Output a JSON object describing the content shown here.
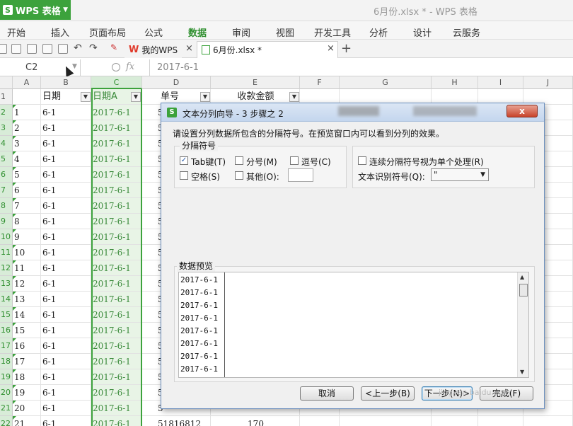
{
  "app": {
    "name": "WPS 表格",
    "logo": "S",
    "window_title": "6月份.xlsx * - WPS 表格"
  },
  "menu": {
    "items": [
      "开始",
      "插入",
      "页面布局",
      "公式",
      "数据",
      "审阅",
      "视图",
      "开发工具",
      "分析",
      "设计",
      "云服务"
    ],
    "active": "数据"
  },
  "tabs": {
    "home_label": "我的WPS",
    "doc_label": "6月份.xlsx *",
    "close_glyph": "×",
    "add_glyph": "+"
  },
  "formula": {
    "cell_ref": "C2",
    "fx": "fx",
    "value": "2017-6-1"
  },
  "sheet": {
    "columns": [
      "A",
      "B",
      "C",
      "D",
      "E",
      "F",
      "G",
      "H",
      "I",
      "J"
    ],
    "header_row": {
      "a": "",
      "b": "日期",
      "c": "日期A",
      "d": "单号",
      "e": "收款金额"
    },
    "rows": [
      {
        "n": "1",
        "a": "",
        "b": "",
        "c": ""
      },
      {
        "n": "2",
        "a": "1",
        "b": "6-1",
        "c": "2017-6-1"
      },
      {
        "n": "3",
        "a": "2",
        "b": "6-1",
        "c": "2017-6-1"
      },
      {
        "n": "4",
        "a": "3",
        "b": "6-1",
        "c": "2017-6-1"
      },
      {
        "n": "5",
        "a": "4",
        "b": "6-1",
        "c": "2017-6-1"
      },
      {
        "n": "6",
        "a": "5",
        "b": "6-1",
        "c": "2017-6-1"
      },
      {
        "n": "7",
        "a": "6",
        "b": "6-1",
        "c": "2017-6-1"
      },
      {
        "n": "8",
        "a": "7",
        "b": "6-1",
        "c": "2017-6-1"
      },
      {
        "n": "9",
        "a": "8",
        "b": "6-1",
        "c": "2017-6-1"
      },
      {
        "n": "10",
        "a": "9",
        "b": "6-1",
        "c": "2017-6-1"
      },
      {
        "n": "11",
        "a": "10",
        "b": "6-1",
        "c": "2017-6-1"
      },
      {
        "n": "12",
        "a": "11",
        "b": "6-1",
        "c": "2017-6-1"
      },
      {
        "n": "13",
        "a": "12",
        "b": "6-1",
        "c": "2017-6-1"
      },
      {
        "n": "14",
        "a": "13",
        "b": "6-1",
        "c": "2017-6-1"
      },
      {
        "n": "15",
        "a": "14",
        "b": "6-1",
        "c": "2017-6-1"
      },
      {
        "n": "16",
        "a": "15",
        "b": "6-1",
        "c": "2017-6-1"
      },
      {
        "n": "17",
        "a": "16",
        "b": "6-1",
        "c": "2017-6-1"
      },
      {
        "n": "18",
        "a": "17",
        "b": "6-1",
        "c": "2017-6-1"
      },
      {
        "n": "19",
        "a": "18",
        "b": "6-1",
        "c": "2017-6-1"
      },
      {
        "n": "20",
        "a": "19",
        "b": "6-1",
        "c": "2017-6-1"
      },
      {
        "n": "21",
        "a": "20",
        "b": "6-1",
        "c": "2017-6-1"
      },
      {
        "n": "22",
        "a": "21",
        "b": "6-1",
        "c": "2017-6-1"
      }
    ],
    "last_row": {
      "d": "51816812",
      "e": "170"
    },
    "d_partial": "5",
    "filter_glyph": "▼"
  },
  "dialog": {
    "logo": "S",
    "title": "文本分列向导 - 3 步骤之 2",
    "close_glyph": "x",
    "instruction": "请设置分列数据所包含的分隔符号。在预览窗口内可以看到分列的效果。",
    "delimiter_group": "分隔符号",
    "tab": {
      "label": "Tab键(T)",
      "checked": true
    },
    "semicolon": {
      "label": "分号(M)",
      "checked": false
    },
    "comma": {
      "label": "逗号(C)",
      "checked": false
    },
    "space": {
      "label": "空格(S)",
      "checked": false
    },
    "other": {
      "label": "其他(O):",
      "checked": false,
      "value": ""
    },
    "consecutive": {
      "label": "连续分隔符号视为单个处理(R)",
      "checked": false
    },
    "qualifier_label": "文本识别符号(Q):",
    "qualifier_value": "\"",
    "preview_label": "数据预览",
    "preview_lines": [
      "2017-6-1",
      "2017-6-1",
      "2017-6-1",
      "2017-6-1",
      "2017-6-1",
      "2017-6-1",
      "2017-6-1",
      "2017-6-1"
    ],
    "buttons": {
      "cancel": "取消",
      "back": "<上一步(B)",
      "next": "下一步(N)>",
      "finish": "完成(F)"
    }
  },
  "watermark": "jingyan.baidu.com"
}
